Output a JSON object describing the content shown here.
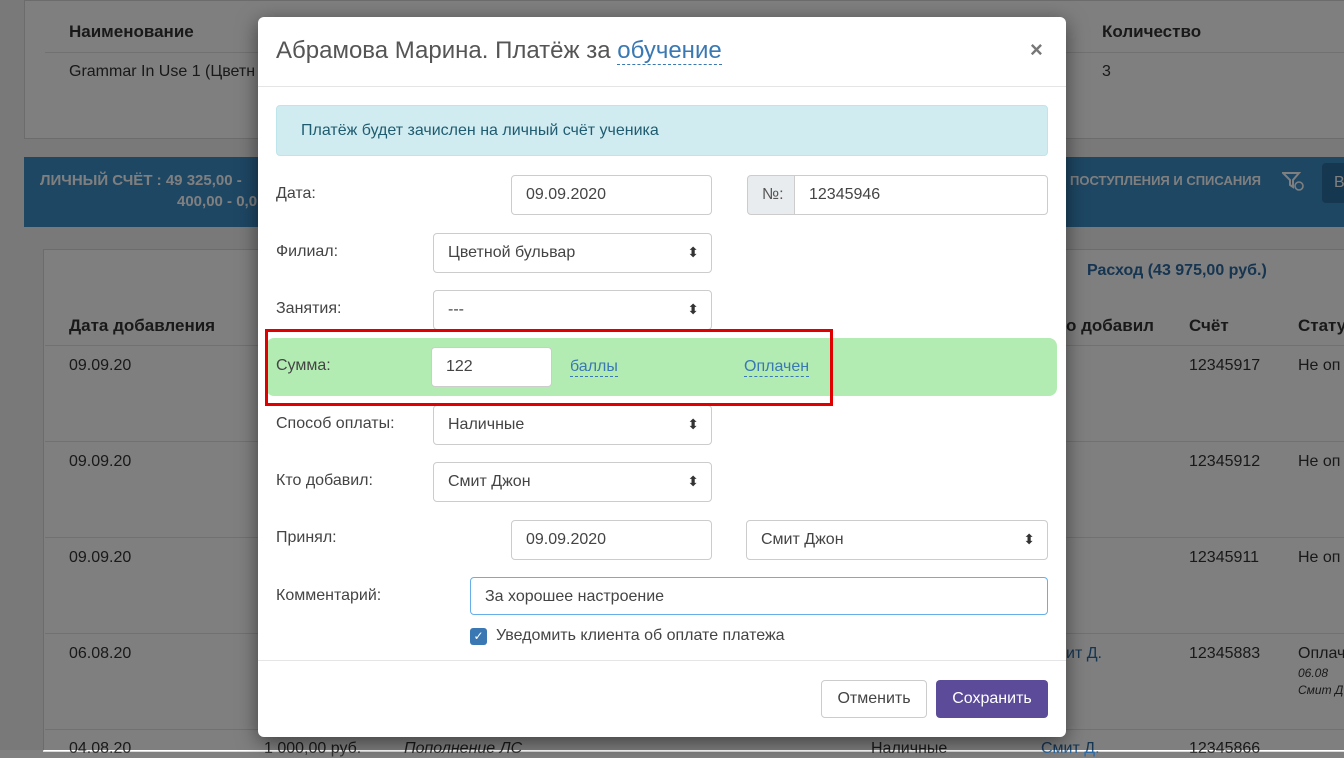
{
  "background": {
    "top_table": {
      "headers": [
        "Наименование",
        "Количество"
      ],
      "row": [
        "Grammar In Use 1 (Цветн",
        "3"
      ]
    },
    "account": {
      "label": "ЛИЧНЫЙ СЧЁТ :  49 325,00 -",
      "label2": "400,00 - 0,0",
      "filter_label": "ПОСТУПЛЕНИЯ И СПИСАНИЯ",
      "btn": "В"
    },
    "expense_link": "Расход (43 975,00 руб.)",
    "columns": [
      "Дата добавления",
      "о добавил",
      "Счёт",
      "Стату"
    ],
    "rows": [
      {
        "date": "09.09.20",
        "account": "12345917",
        "status": "Не оп",
        "status_color": "red"
      },
      {
        "date": "09.09.20",
        "account": "12345912",
        "status": "Не оп",
        "status_color": "red"
      },
      {
        "date": "09.09.20",
        "account": "12345911",
        "status": "Не оп",
        "status_color": "red"
      },
      {
        "date": "06.08.20",
        "added": "ит Д.",
        "account": "12345883",
        "status": "Оплач",
        "sub1": "06.08",
        "sub2": "Смит Д",
        "status_color": "green"
      }
    ],
    "bottom_row": {
      "date": "04.08.20",
      "amount": "1 000,00 руб.",
      "desc": "Пополнение ЛС",
      "method": "Наличные",
      "added": "Смит Д.",
      "account": "12345866"
    }
  },
  "modal": {
    "title_prefix": "Абрамова Марина. Платёж за",
    "title_link": "обучение",
    "close": "×",
    "alert": "Платёж будет зачислен на личный счёт ученика",
    "date_label": "Дата:",
    "date_value": "09.09.2020",
    "number_addon": "№:",
    "number_value": "12345946",
    "branch_label": "Филиал:",
    "branch_value": "Цветной бульвар",
    "lessons_label": "Занятия:",
    "lessons_value": "---",
    "sum_label": "Сумма:",
    "sum_value": "122",
    "unit_link": "баллы",
    "paid_link": "Оплачен",
    "method_label": "Способ оплаты:",
    "method_value": "Наличные",
    "added_label": "Кто добавил:",
    "added_value": "Смит Джон",
    "accepted_label": "Принял:",
    "accepted_date": "09.09.2020",
    "accepted_by": "Смит Джон",
    "comment_label": "Комментарий:",
    "comment_value": "За хорошее настроение",
    "notify_label": "Уведомить клиента об оплате платежа",
    "notify_checked": true,
    "cancel": "Отменить",
    "save": "Сохранить"
  },
  "colors": {
    "accent": "#5c4b99",
    "link": "#3a78b3",
    "highlight": "#b3ecb3",
    "frame": "#e00000"
  }
}
